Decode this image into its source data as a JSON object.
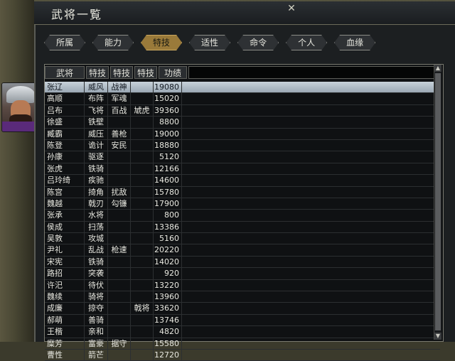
{
  "window": {
    "title": "武将一覧"
  },
  "tabs": [
    {
      "label": "所属",
      "active": false
    },
    {
      "label": "能力",
      "active": false
    },
    {
      "label": "特技",
      "active": true
    },
    {
      "label": "适性",
      "active": false
    },
    {
      "label": "命令",
      "active": false
    },
    {
      "label": "个人",
      "active": false
    },
    {
      "label": "血缘",
      "active": false
    }
  ],
  "table": {
    "headers": [
      "武将",
      "特技",
      "特技",
      "特技",
      "功绩"
    ],
    "rows": [
      [
        "张辽",
        "威风",
        "战神",
        "",
        "19080"
      ],
      [
        "高顺",
        "布阵",
        "军魂",
        "",
        "15020"
      ],
      [
        "吕布",
        "飞将",
        "百战",
        "虓虎",
        "39360"
      ],
      [
        "徐盛",
        "铁壁",
        "",
        "",
        "8800"
      ],
      [
        "臧霸",
        "威压",
        "善枪",
        "",
        "19000"
      ],
      [
        "陈登",
        "诡计",
        "安民",
        "",
        "18880"
      ],
      [
        "孙康",
        "驱逐",
        "",
        "",
        "5120"
      ],
      [
        "张虎",
        "铁骑",
        "",
        "",
        "12166"
      ],
      [
        "吕玲绮",
        "疾驰",
        "",
        "",
        "14600"
      ],
      [
        "陈宫",
        "掎角",
        "扰敌",
        "",
        "15780"
      ],
      [
        "魏越",
        "戟刃",
        "勾镰",
        "",
        "17900"
      ],
      [
        "张承",
        "水将",
        "",
        "",
        "800"
      ],
      [
        "侯成",
        "扫荡",
        "",
        "",
        "13386"
      ],
      [
        "吴敦",
        "攻城",
        "",
        "",
        "5160"
      ],
      [
        "尹礼",
        "乱战",
        "枪速",
        "",
        "20220"
      ],
      [
        "宋宪",
        "铁骑",
        "",
        "",
        "14020"
      ],
      [
        "路招",
        "突袭",
        "",
        "",
        "920"
      ],
      [
        "许汜",
        "待伏",
        "",
        "",
        "13220"
      ],
      [
        "魏续",
        "骑将",
        "",
        "",
        "13960"
      ],
      [
        "成廉",
        "掠夺",
        "",
        "戟将",
        "33620"
      ],
      [
        "郝萌",
        "善骑",
        "",
        "",
        "13746"
      ],
      [
        "王楷",
        "亲和",
        "",
        "",
        "4820"
      ],
      [
        "糜芳",
        "富豪",
        "据守",
        "",
        "15580"
      ],
      [
        "曹性",
        "箭芒",
        "",
        "",
        "12720"
      ]
    ],
    "selected_index": 0
  },
  "icons": {
    "close": "close-icon",
    "scroll_up": "scroll-up-arrow-icon",
    "scroll_down": "scroll-down-arrow-icon"
  }
}
